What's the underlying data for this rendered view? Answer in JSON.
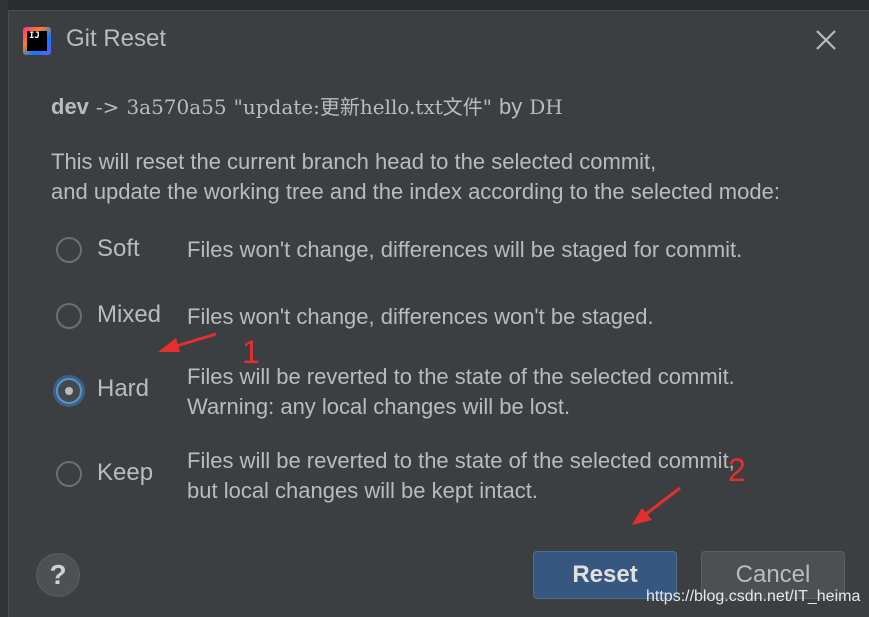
{
  "dialog": {
    "title": "Git Reset",
    "app_icon_text": "IJ",
    "commit": {
      "branch": "dev",
      "arrow": "->",
      "hash": "3a570a55",
      "message": "\"update:更新hello.txt文件\"",
      "by": "by",
      "author": "DH"
    },
    "description": [
      "This will reset the current branch head to the selected commit,",
      "and update the working tree and the index according to the selected mode:"
    ],
    "options": [
      {
        "label": "Soft",
        "checked": false,
        "desc": [
          "Files won't change, differences will be staged for commit."
        ]
      },
      {
        "label": "Mixed",
        "checked": false,
        "desc": [
          "Files won't change, differences won't be staged."
        ]
      },
      {
        "label": "Hard",
        "checked": true,
        "desc": [
          "Files will be reverted to the state of the selected commit.",
          "Warning: any local changes will be lost."
        ]
      },
      {
        "label": "Keep",
        "checked": false,
        "desc": [
          "Files will be reverted to the state of the selected commit,",
          "but local changes will be kept intact."
        ]
      }
    ],
    "help_label": "?",
    "reset_label": "Reset",
    "cancel_label": "Cancel"
  },
  "annotations": {
    "marker_1": "1",
    "marker_2": "2",
    "color": "#e52e2e"
  },
  "watermark": "https://blog.csdn.net/IT_heima",
  "colors": {
    "dialog_bg": "#3c3f41",
    "primary_button": "#365880",
    "radio_focus": "#5794ca"
  }
}
